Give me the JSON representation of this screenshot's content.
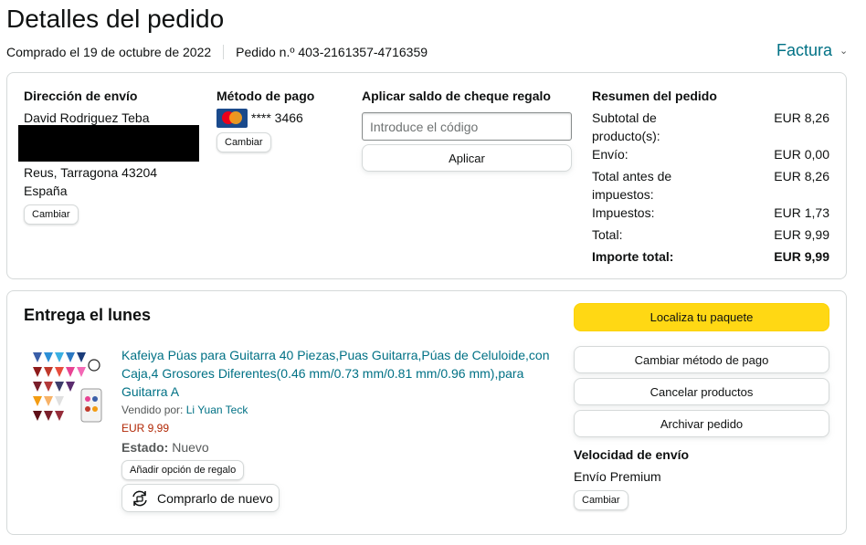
{
  "header": {
    "title": "Detalles del pedido",
    "purchased": "Comprado el 19 de octubre de 2022",
    "order_number": "Pedido n.º 403-2161357-4716359",
    "invoice": "Factura"
  },
  "shipping": {
    "heading": "Dirección de envío",
    "name": "David Rodriguez Teba",
    "city": "Reus, Tarragona 43204",
    "country": "España",
    "change": "Cambiar"
  },
  "payment": {
    "heading": "Método de pago",
    "card": "**** 3466",
    "card_brand_icon": "mastercard-icon",
    "change": "Cambiar"
  },
  "gift": {
    "heading": "Aplicar saldo de cheque regalo",
    "placeholder": "Introduce el código",
    "apply": "Aplicar"
  },
  "summary": {
    "heading": "Resumen del pedido",
    "rows": [
      {
        "label": "Subtotal de producto(s):",
        "value": "EUR 8,26"
      },
      {
        "label": "Envío:",
        "value": "EUR 0,00"
      },
      {
        "label": "Total antes de impuestos:",
        "value": "EUR 8,26"
      },
      {
        "label": "Impuestos:",
        "value": "EUR 1,73"
      },
      {
        "label": "Total:",
        "value": "EUR 9,99"
      },
      {
        "label": "Importe total:",
        "value": "EUR 9,99"
      }
    ]
  },
  "delivery": {
    "heading": "Entrega el lunes",
    "product_title": "Kafeiya Púas para Guitarra 40 Piezas,Puas Guitarra,Púas de Celuloide,con Caja,4 Grosores Diferentes(0.46 mm/0.73 mm/0.81 mm/0.96 mm),para Guitarra A",
    "sold_by_label": "Vendido por:",
    "seller": "Li Yuan Teck",
    "price": "EUR 9,99",
    "state_label": "Estado:",
    "state": "Nuevo",
    "gift_option": "Añadir opción de regalo",
    "buy_again": "Comprarlo de nuevo"
  },
  "actions": {
    "track": "Localiza tu paquete",
    "change_payment": "Cambiar método de pago",
    "cancel": "Cancelar productos",
    "archive": "Archivar pedido",
    "speed_heading": "Velocidad de envío",
    "speed": "Envío Premium",
    "change": "Cambiar"
  },
  "colors": {
    "link": "#007185",
    "price": "#b12704",
    "primary_button": "#ffd814"
  }
}
